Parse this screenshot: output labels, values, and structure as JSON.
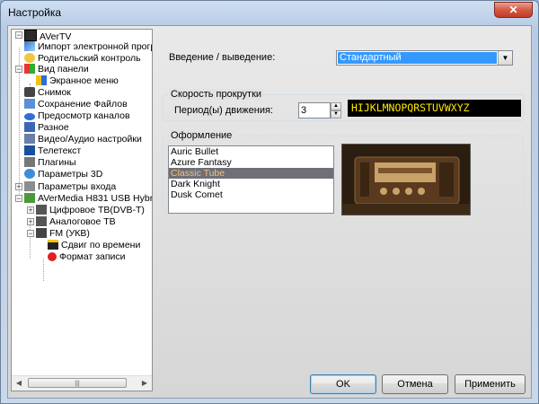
{
  "window": {
    "title": "Настройка",
    "close_glyph": "✕"
  },
  "tree": {
    "items": [
      {
        "label": "AVerTV",
        "icon": "averTV-icon"
      },
      {
        "label": "Импорт электронной прогр",
        "icon": "import-icon"
      },
      {
        "label": "Родительский контроль",
        "icon": "parental-icon"
      },
      {
        "label": "Вид панели",
        "icon": "panel-view-icon"
      },
      {
        "label": "Экранное меню",
        "icon": "osd-icon"
      },
      {
        "label": "Снимок",
        "icon": "camera-icon"
      },
      {
        "label": "Сохранение Файлов",
        "icon": "save-files-icon"
      },
      {
        "label": "Предосмотр каналов",
        "icon": "eye-icon"
      },
      {
        "label": "Разное",
        "icon": "misc-icon"
      },
      {
        "label": "Видео/Аудио настройки",
        "icon": "tools-icon"
      },
      {
        "label": "Телетекст",
        "icon": "teletext-icon"
      },
      {
        "label": "Плагины",
        "icon": "plugins-icon"
      },
      {
        "label": "Параметры 3D",
        "icon": "3d-icon"
      },
      {
        "label": "Параметры входа",
        "icon": "input-params-icon"
      },
      {
        "label": "AVerMedia H831 USB Hybri",
        "icon": "device-icon"
      },
      {
        "label": "Цифровое ТВ(DVB-T)",
        "icon": "tv-icon"
      },
      {
        "label": "Аналоговое ТВ",
        "icon": "tv-icon"
      },
      {
        "label": "FM (УКВ)",
        "icon": "radio-icon"
      },
      {
        "label": "Сдвиг по времени",
        "icon": "timeshift-icon"
      },
      {
        "label": "Формат записи",
        "icon": "record-icon"
      }
    ],
    "scroll_thumb_glyph": "|||"
  },
  "panel": {
    "input_output_label": "Введение / выведение:",
    "input_output_value": "Стандартный",
    "scroll_group_title": "Скорость прокрутки",
    "period_label": "Период(ы) движения:",
    "period_value": "3",
    "marquee_text": "HIJKLMNOPQRSTUVWXYZ",
    "design_group_title": "Оформление",
    "skins": [
      "Auric Bullet",
      "Azure Fantasy",
      "Classic Tube",
      "Dark Knight",
      "Dusk Comet"
    ],
    "selected_skin_index": 2
  },
  "buttons": {
    "ok": "OK",
    "cancel": "Отмена",
    "apply": "Применить"
  },
  "colors": {
    "selection": "#3399ff",
    "marquee_text": "#ffe600",
    "skin_selected_bg": "#6f6f78"
  }
}
